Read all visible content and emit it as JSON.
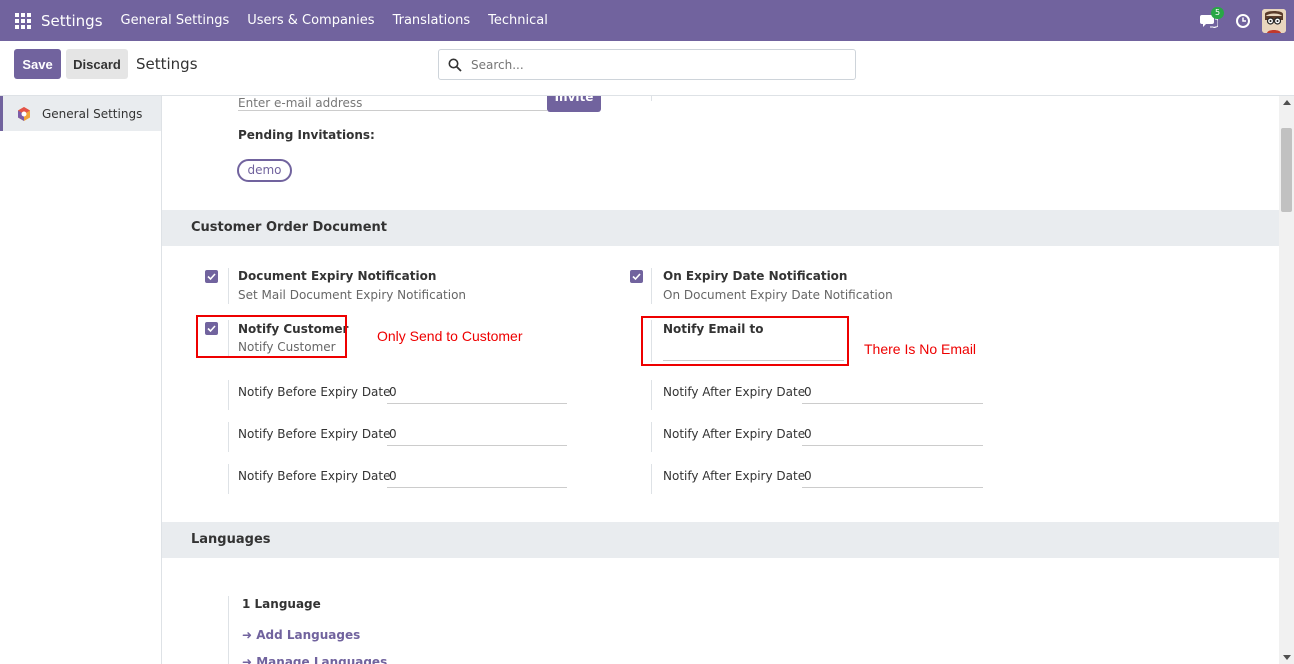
{
  "navbar": {
    "brand": "Settings",
    "menu": [
      "General Settings",
      "Users & Companies",
      "Translations",
      "Technical"
    ],
    "chat_badge": "5",
    "bg_color": "#71639e"
  },
  "control_panel": {
    "save_label": "Save",
    "discard_label": "Discard",
    "title": "Settings",
    "search_placeholder": "Search..."
  },
  "sidebar": {
    "items": [
      {
        "label": "General Settings",
        "icon": "odoo-logo-icon"
      }
    ]
  },
  "users": {
    "email_placeholder": "Enter e-mail address",
    "invite_label": "Invite",
    "pending_label": "Pending Invitations:",
    "pending": [
      "demo"
    ]
  },
  "customer_order": {
    "header": "Customer Order Document",
    "expiry_notification": {
      "title": "Document Expiry Notification",
      "desc": "Set Mail Document Expiry Notification",
      "checked": true
    },
    "on_expiry_notification": {
      "title": "On Expiry Date Notification",
      "desc": "On Document Expiry Date Notification",
      "checked": true
    },
    "notify_customer": {
      "title": "Notify Customer",
      "desc": "Notify Customer",
      "checked": true
    },
    "notify_email": {
      "title": "Notify Email to",
      "value": ""
    },
    "before_rows": [
      {
        "label": "Notify Before Expiry Date",
        "value": "0"
      },
      {
        "label": "Notify Before Expiry Date",
        "value": "0"
      },
      {
        "label": "Notify Before Expiry Date",
        "value": "0"
      }
    ],
    "after_rows": [
      {
        "label": "Notify After Expiry Date",
        "value": "0"
      },
      {
        "label": "Notify After Expiry Date",
        "value": "0"
      },
      {
        "label": "Notify After Expiry Date",
        "value": "0"
      }
    ]
  },
  "annotations": {
    "left_note": "Only Send to Customer",
    "right_note": "There Is No Email",
    "color": "#ee0000"
  },
  "languages": {
    "header": "Languages",
    "count": "1 Language",
    "add_link": "Add Languages",
    "manage_link": "Manage Languages"
  }
}
